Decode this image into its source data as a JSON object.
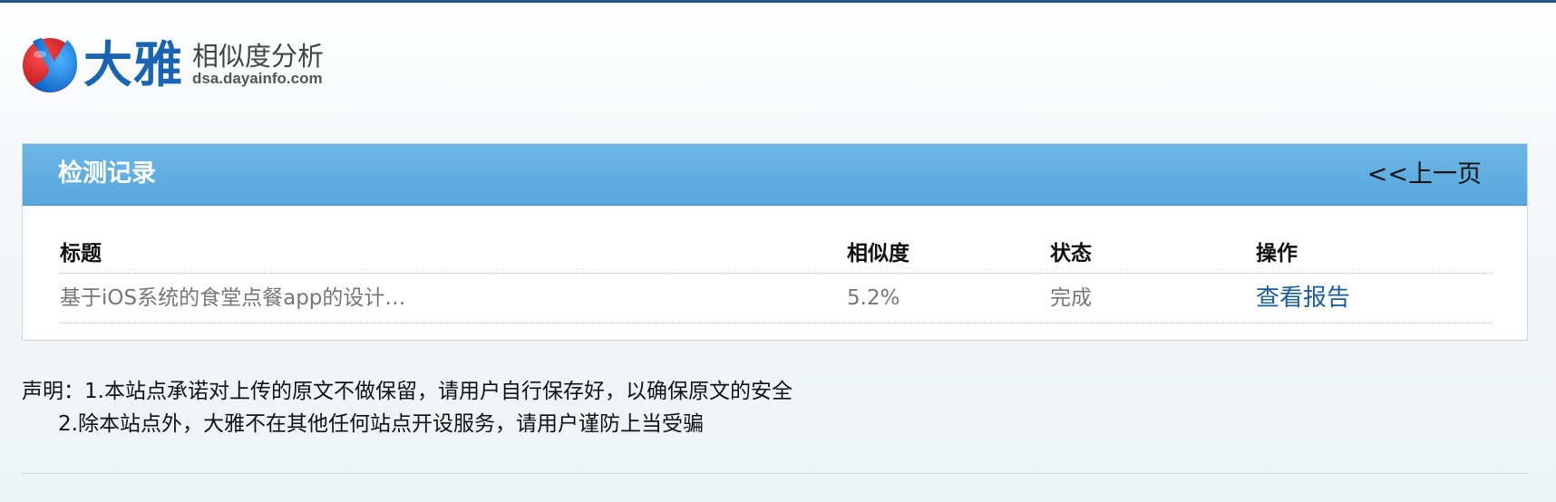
{
  "logo": {
    "brand": "大雅",
    "subtitle": "相似度分析",
    "domain": "dsa.dayainfo.com",
    "icon": "logo-mark-icon",
    "colors": {
      "red": "#d81e28",
      "blue": "#1a64b4"
    }
  },
  "panel": {
    "title": "检测记录",
    "prev_label": "<<上一页",
    "header_color": "#5aa9de"
  },
  "table": {
    "columns": [
      "标题",
      "相似度",
      "状态",
      "操作"
    ],
    "rows": [
      {
        "title": "基于iOS系统的食堂点餐app的设计…",
        "similarity": "5.2%",
        "status": "完成",
        "action": "查看报告"
      }
    ]
  },
  "notice": {
    "line1": "声明：1.本站点承诺对上传的原文不做保留，请用户自行保存好，以确保原文的安全",
    "line2": "2.除本站点外，大雅不在其他任何站点开设服务，请用户谨防上当受骗"
  }
}
